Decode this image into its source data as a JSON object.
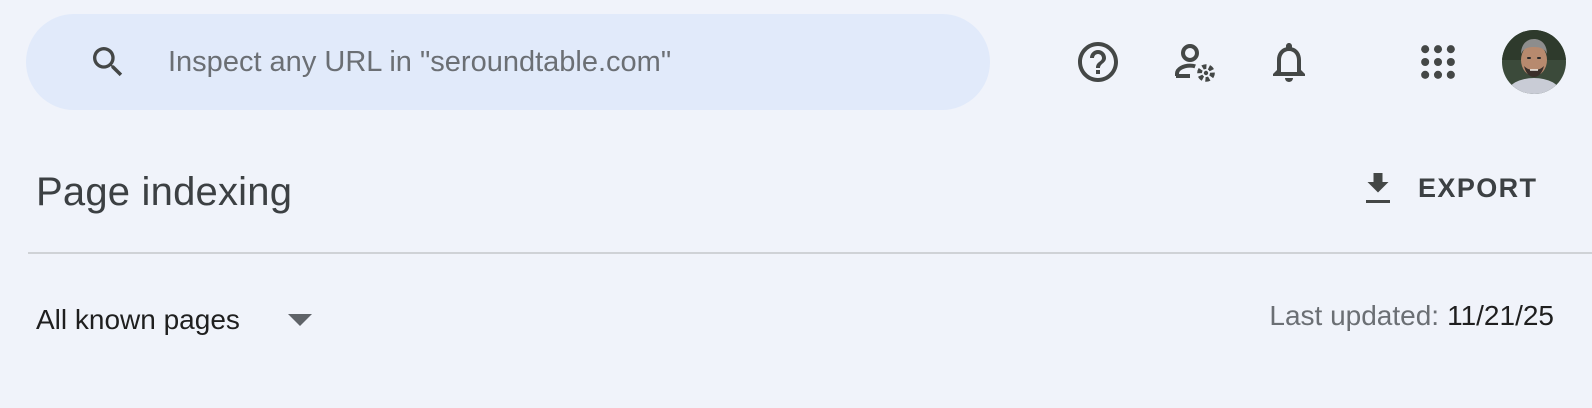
{
  "search": {
    "placeholder": "Inspect any URL in \"seroundtable.com\"",
    "icon": "search-icon"
  },
  "topbar": {
    "icons": [
      "help-icon",
      "admin-settings-icon",
      "notifications-bell-icon",
      "apps-grid-icon"
    ],
    "avatar": "user-avatar"
  },
  "page": {
    "title": "Page indexing",
    "export_label": "EXPORT",
    "export_icon": "download-icon"
  },
  "filter": {
    "selected": "All known pages",
    "chevron_icon": "chevron-down-icon"
  },
  "status": {
    "last_updated_label": "Last updated:",
    "last_updated_value": "11/21/25"
  },
  "colors": {
    "background": "#f0f3fa",
    "search_background": "#e1eafa",
    "icon_color": "#444746",
    "divider": "#cfd2d6"
  }
}
